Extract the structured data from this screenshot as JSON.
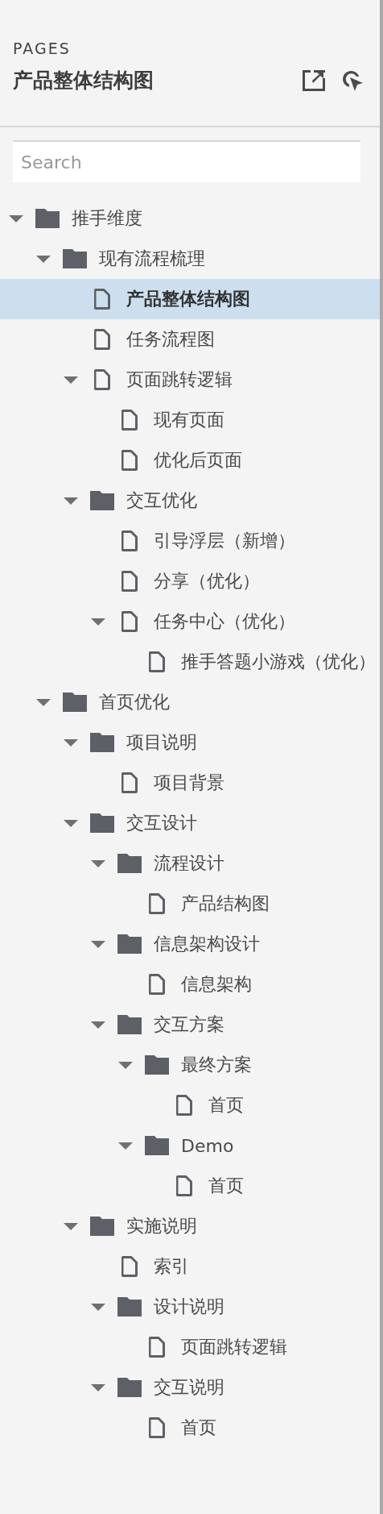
{
  "panel": {
    "heading": "PAGES",
    "current_page": "产品整体结构图"
  },
  "search": {
    "placeholder": "Search"
  },
  "tree": [
    {
      "label": "推手维度",
      "kind": "folder",
      "expanded": true,
      "selected": false,
      "children": [
        {
          "label": "现有流程梳理",
          "kind": "folder",
          "expanded": true,
          "selected": false,
          "children": [
            {
              "label": "产品整体结构图",
              "kind": "page",
              "selected": true
            },
            {
              "label": "任务流程图",
              "kind": "page",
              "selected": false
            },
            {
              "label": "页面跳转逻辑",
              "kind": "page",
              "expanded": true,
              "selected": false,
              "children": [
                {
                  "label": "现有页面",
                  "kind": "page",
                  "selected": false
                },
                {
                  "label": "优化后页面",
                  "kind": "page",
                  "selected": false
                }
              ]
            },
            {
              "label": "交互优化",
              "kind": "folder",
              "expanded": true,
              "selected": false,
              "children": [
                {
                  "label": "引导浮层（新增）",
                  "kind": "page",
                  "selected": false
                },
                {
                  "label": "分享（优化）",
                  "kind": "page",
                  "selected": false
                },
                {
                  "label": "任务中心（优化）",
                  "kind": "page",
                  "expanded": true,
                  "selected": false,
                  "children": [
                    {
                      "label": "推手答题小游戏（优化）",
                      "kind": "page",
                      "selected": false
                    }
                  ]
                }
              ]
            }
          ]
        },
        {
          "label": "首页优化",
          "kind": "folder",
          "expanded": true,
          "selected": false,
          "children": [
            {
              "label": "项目说明",
              "kind": "folder",
              "expanded": true,
              "selected": false,
              "children": [
                {
                  "label": "项目背景",
                  "kind": "page",
                  "selected": false
                }
              ]
            },
            {
              "label": "交互设计",
              "kind": "folder",
              "expanded": true,
              "selected": false,
              "children": [
                {
                  "label": "流程设计",
                  "kind": "folder",
                  "expanded": true,
                  "selected": false,
                  "children": [
                    {
                      "label": "产品结构图",
                      "kind": "page",
                      "selected": false
                    }
                  ]
                },
                {
                  "label": "信息架构设计",
                  "kind": "folder",
                  "expanded": true,
                  "selected": false,
                  "children": [
                    {
                      "label": "信息架构",
                      "kind": "page",
                      "selected": false
                    }
                  ]
                },
                {
                  "label": "交互方案",
                  "kind": "folder",
                  "expanded": true,
                  "selected": false,
                  "children": [
                    {
                      "label": "最终方案",
                      "kind": "folder",
                      "expanded": true,
                      "selected": false,
                      "children": [
                        {
                          "label": "首页",
                          "kind": "page",
                          "selected": false
                        }
                      ]
                    },
                    {
                      "label": "Demo",
                      "kind": "folder",
                      "expanded": true,
                      "selected": false,
                      "children": [
                        {
                          "label": "首页",
                          "kind": "page",
                          "selected": false
                        }
                      ]
                    }
                  ]
                }
              ]
            },
            {
              "label": "实施说明",
              "kind": "folder",
              "expanded": true,
              "selected": false,
              "children": [
                {
                  "label": "索引",
                  "kind": "page",
                  "selected": false
                },
                {
                  "label": "设计说明",
                  "kind": "folder",
                  "expanded": true,
                  "selected": false,
                  "children": [
                    {
                      "label": "页面跳转逻辑",
                      "kind": "page",
                      "selected": false
                    }
                  ]
                },
                {
                  "label": "交互说明",
                  "kind": "folder",
                  "expanded": true,
                  "selected": false,
                  "children": [
                    {
                      "label": "首页",
                      "kind": "page",
                      "selected": false
                    }
                  ]
                }
              ]
            }
          ]
        }
      ]
    }
  ]
}
